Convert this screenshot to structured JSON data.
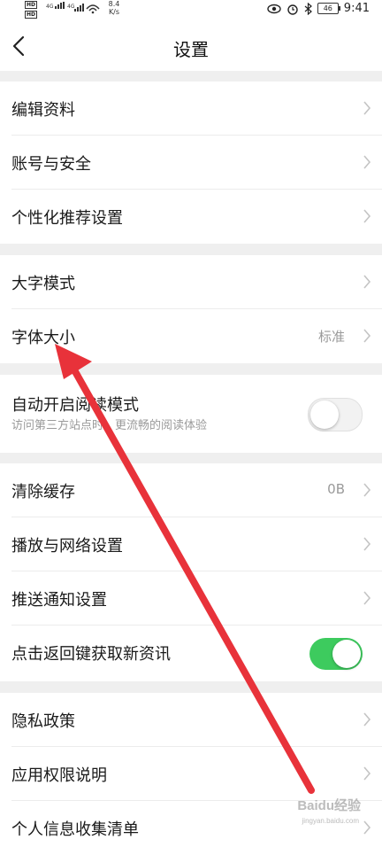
{
  "status_bar": {
    "network_speed": "8.4",
    "speed_unit": "K/s",
    "battery_level": "46",
    "time": "9:41",
    "icons": [
      "hd-icon",
      "signal-icon",
      "wifi-icon",
      "eye-icon",
      "alarm-icon",
      "bluetooth-icon",
      "battery-icon"
    ]
  },
  "header": {
    "title": "设置",
    "back_icon": "chevron-left-icon"
  },
  "sections": [
    {
      "items": [
        {
          "label": "编辑资料"
        },
        {
          "label": "账号与安全"
        },
        {
          "label": "个性化推荐设置"
        }
      ]
    },
    {
      "items": [
        {
          "label": "大字模式"
        },
        {
          "label": "字体大小",
          "value": "标准"
        }
      ]
    },
    {
      "items": [
        {
          "label": "自动开启阅读模式",
          "subtitle": "访问第三方站点时，更流畅的阅读体验",
          "toggle": "off"
        }
      ]
    },
    {
      "items": [
        {
          "label": "清除缓存",
          "value": "0B"
        },
        {
          "label": "播放与网络设置"
        },
        {
          "label": "推送通知设置"
        },
        {
          "label": "点击返回键获取新资讯",
          "toggle": "on"
        }
      ]
    },
    {
      "items": [
        {
          "label": "隐私政策"
        },
        {
          "label": "应用权限说明"
        },
        {
          "label": "个人信息收集清单"
        }
      ]
    }
  ],
  "watermark": {
    "text": "Baidu经验",
    "sub": "jingyan.baidu.com"
  },
  "colors": {
    "toggle_on": "#3dcb5e",
    "annotation_arrow": "#e8323a",
    "section_gap": "#efefef"
  }
}
